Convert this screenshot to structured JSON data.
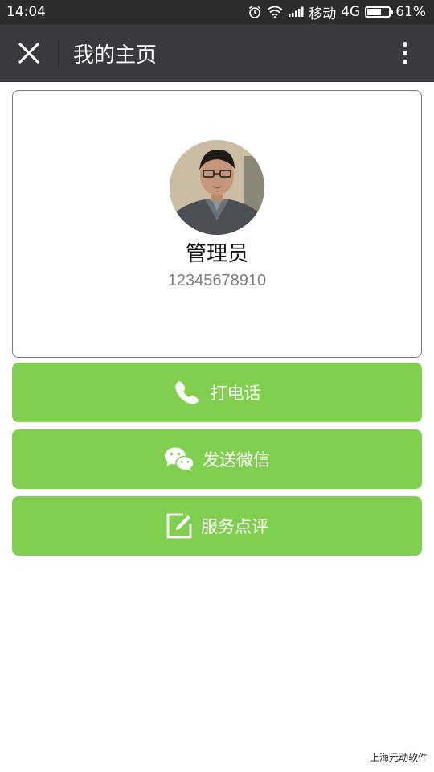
{
  "status_bar": {
    "time": "14:04",
    "carrier": "移动",
    "network": "4G",
    "battery": "61%",
    "battery_level": 0.61
  },
  "header": {
    "title": "我的主页"
  },
  "profile": {
    "name": "管理员",
    "phone": "12345678910"
  },
  "actions": [
    {
      "label": "打电话",
      "icon": "phone-icon"
    },
    {
      "label": "发送微信",
      "icon": "wechat-icon"
    },
    {
      "label": "服务点评",
      "icon": "edit-icon"
    }
  ],
  "footer": {
    "text": "上海元动软件"
  },
  "colors": {
    "accent": "#80cf4f",
    "titlebar": "#393a3f",
    "statusbar": "#2c2c2c"
  }
}
